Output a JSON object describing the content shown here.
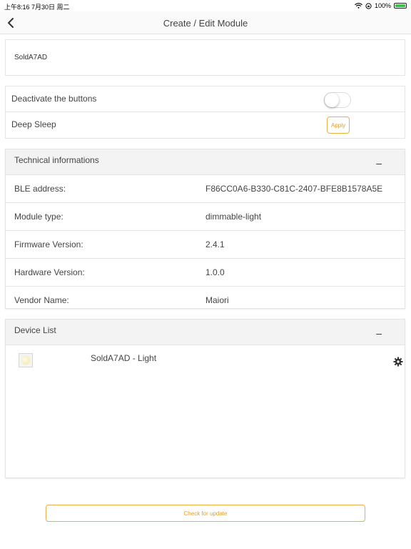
{
  "status_bar": {
    "time_date": "上午8:16  7月30日 周二",
    "battery": "100%",
    "battery_level": 1.0
  },
  "nav": {
    "title": "Create / Edit Module"
  },
  "module": {
    "name": "SoldA7AD"
  },
  "settings": {
    "deactivate_label": "Deactivate the buttons",
    "deactivate_on": false,
    "deep_sleep_label": "Deep Sleep",
    "apply_label": "Apply"
  },
  "technical": {
    "title": "Technical informations",
    "collapse": "–",
    "rows": [
      {
        "key": "BLE address:",
        "value": "F86CC0A6-B330-C81C-2407-BFE8B1578A5E"
      },
      {
        "key": "Module type:",
        "value": "dimmable-light"
      },
      {
        "key": "Firmware Version:",
        "value": "2.4.1"
      },
      {
        "key": "Hardware Version:",
        "value": "1.0.0"
      },
      {
        "key": "Vendor Name:",
        "value": "Maiori"
      }
    ]
  },
  "devices": {
    "title": "Device List",
    "collapse": "–",
    "items": [
      {
        "name": "SoldA7AD - Light"
      }
    ]
  },
  "update_button": "Check for update",
  "colors": {
    "accent": "#e0a030",
    "battery": "#3cc24a",
    "header_bg": "#f3f3f3"
  }
}
